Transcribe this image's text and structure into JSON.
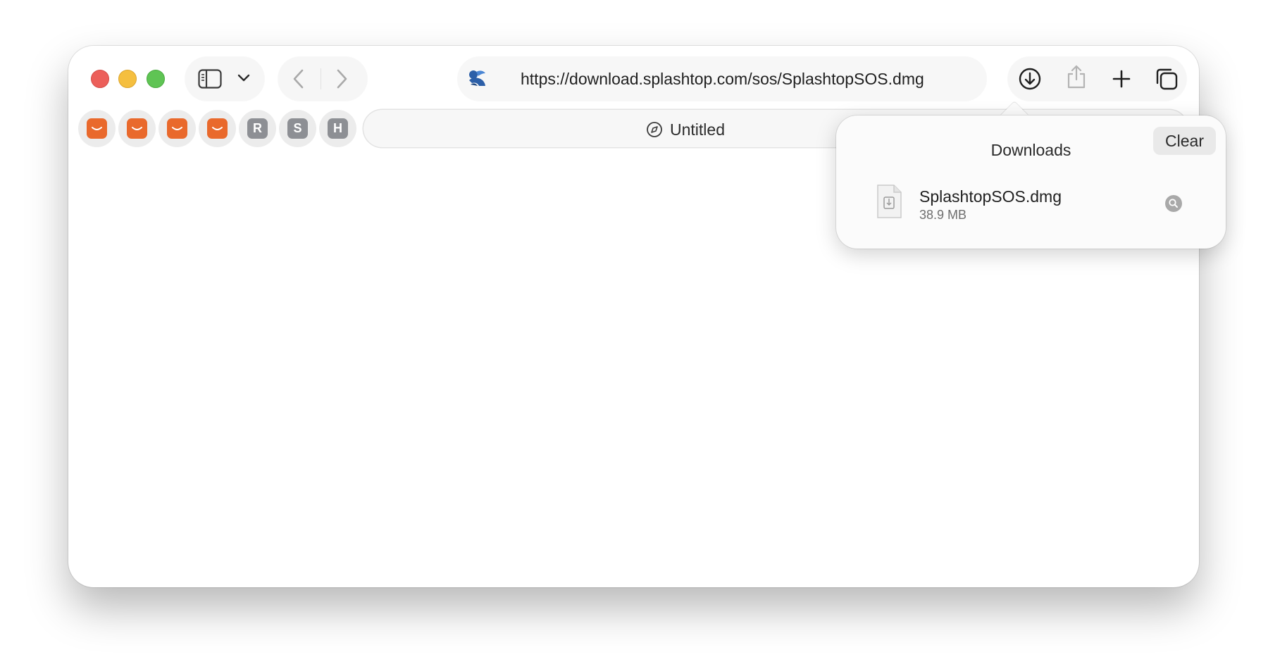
{
  "toolbar": {
    "url": "https://download.splashtop.com/sos/SplashtopSOS.dmg"
  },
  "favorites": [
    {
      "icon": "amazon-icon",
      "letter": ""
    },
    {
      "icon": "amazon-icon",
      "letter": ""
    },
    {
      "icon": "amazon-icon",
      "letter": ""
    },
    {
      "icon": "amazon-icon",
      "letter": ""
    },
    {
      "icon": "letter-icon",
      "letter": "R"
    },
    {
      "icon": "letter-icon",
      "letter": "S"
    },
    {
      "icon": "letter-icon",
      "letter": "H"
    }
  ],
  "tab": {
    "title": "Untitled"
  },
  "downloads": {
    "title": "Downloads",
    "clear_label": "Clear",
    "items": [
      {
        "name": "SplashtopSOS.dmg",
        "size": "38.9 MB"
      }
    ]
  },
  "colors": {
    "close": "#ec5f5a",
    "minimize": "#f5bf3f",
    "maximize": "#5fc454",
    "favorite_orange": "#e9692c",
    "favorite_gray": "#8d8f94"
  }
}
